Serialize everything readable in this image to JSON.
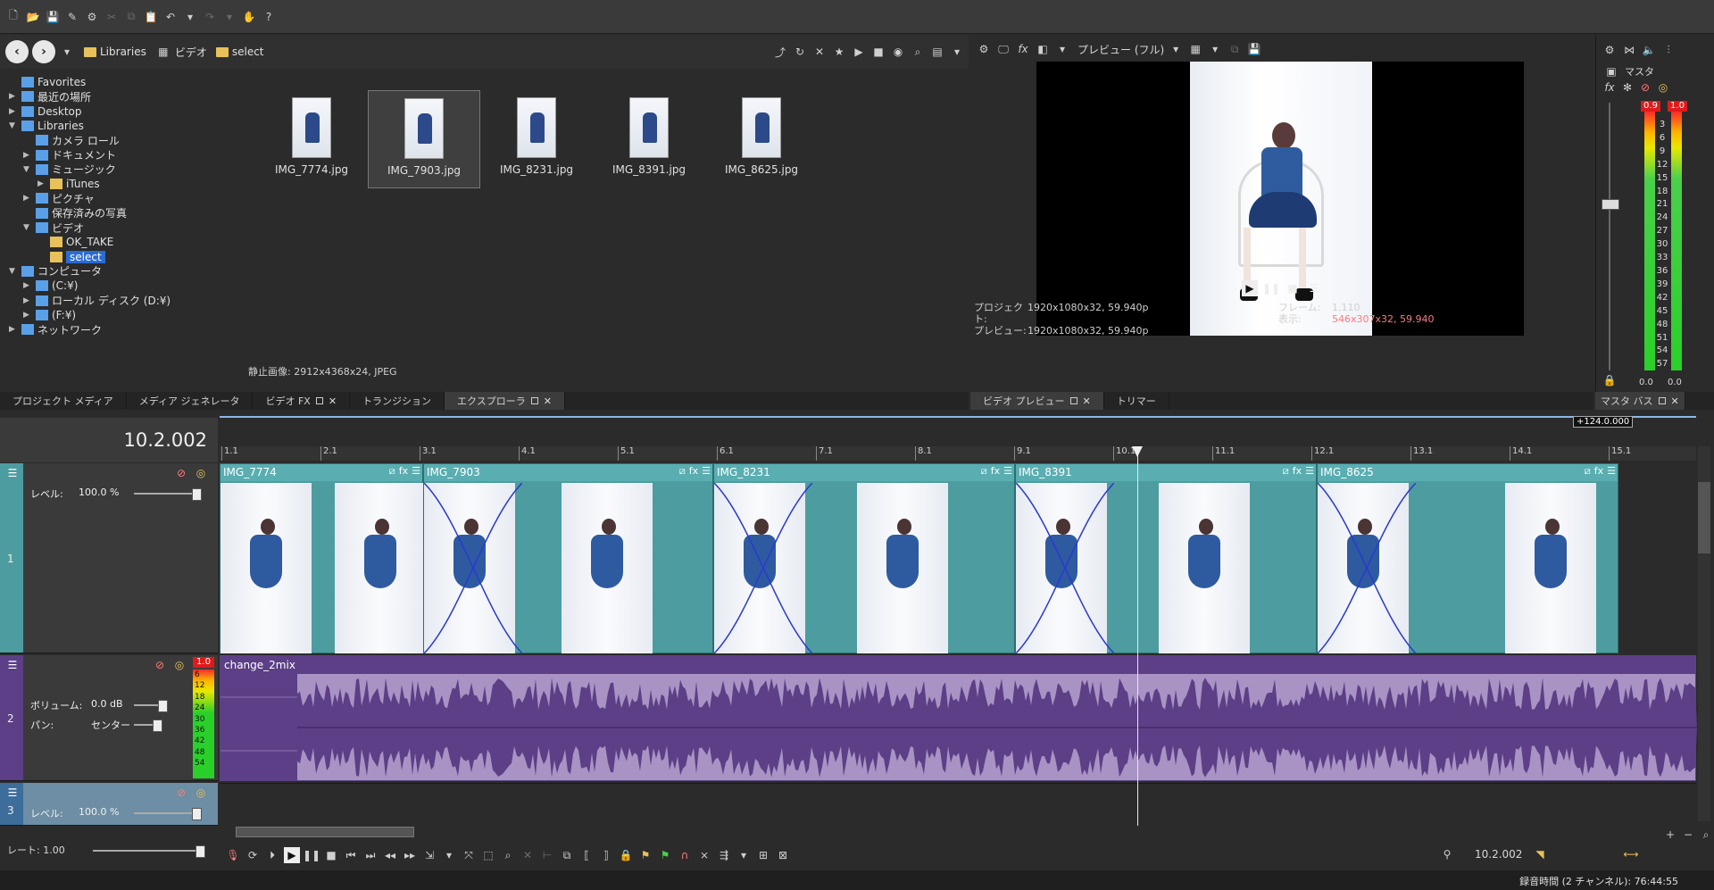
{
  "explorer": {
    "breadcrumb": [
      "Libraries",
      "ビデオ",
      "select"
    ],
    "tree": [
      {
        "label": "Favorites",
        "indent": 0,
        "arrow": ""
      },
      {
        "label": "最近の場所",
        "indent": 0,
        "arrow": "▶"
      },
      {
        "label": "Desktop",
        "indent": 0,
        "arrow": "▶"
      },
      {
        "label": "Libraries",
        "indent": 0,
        "arrow": "▼"
      },
      {
        "label": "カメラ ロール",
        "indent": 1,
        "arrow": ""
      },
      {
        "label": "ドキュメント",
        "indent": 1,
        "arrow": "▶"
      },
      {
        "label": "ミュージック",
        "indent": 1,
        "arrow": "▼"
      },
      {
        "label": "iTunes",
        "indent": 2,
        "arrow": "▶"
      },
      {
        "label": "ピクチャ",
        "indent": 1,
        "arrow": "▶"
      },
      {
        "label": "保存済みの写真",
        "indent": 1,
        "arrow": ""
      },
      {
        "label": "ビデオ",
        "indent": 1,
        "arrow": "▼"
      },
      {
        "label": "OK_TAKE",
        "indent": 2,
        "arrow": ""
      },
      {
        "label": "select",
        "indent": 2,
        "arrow": "",
        "selected": true
      },
      {
        "label": "コンピュータ",
        "indent": 0,
        "arrow": "▼"
      },
      {
        "label": "(C:¥)",
        "indent": 1,
        "arrow": "▶"
      },
      {
        "label": "ローカル ディスク (D:¥)",
        "indent": 1,
        "arrow": "▶"
      },
      {
        "label": "(F:¥)",
        "indent": 1,
        "arrow": "▶"
      },
      {
        "label": "ネットワーク",
        "indent": 0,
        "arrow": "▶"
      }
    ],
    "files": [
      {
        "name": "IMG_7774.jpg",
        "selected": false
      },
      {
        "name": "IMG_7903.jpg",
        "selected": true
      },
      {
        "name": "IMG_8231.jpg",
        "selected": false
      },
      {
        "name": "IMG_8391.jpg",
        "selected": false
      },
      {
        "name": "IMG_8625.jpg",
        "selected": false
      }
    ],
    "status": "静止画像: 2912x4368x24, JPEG",
    "tabs": [
      {
        "label": "プロジェクト メディア"
      },
      {
        "label": "メディア ジェネレータ"
      },
      {
        "label": "ビデオ FX"
      },
      {
        "label": "トランジション"
      },
      {
        "label": "エクスプローラ"
      }
    ]
  },
  "preview": {
    "mode_label": "プレビュー (フル)",
    "info": {
      "project_label": "プロジェクト:",
      "project_value": "1920x1080x32, 59.940p",
      "preview_label": "プレビュー:",
      "preview_value": "1920x1080x32, 59.940p",
      "frame_label": "フレーム:",
      "frame_value": "1,110",
      "display_label": "表示:",
      "display_value": "546x307x32, 59.940"
    },
    "tabs": [
      {
        "label": "ビデオ プレビュー"
      },
      {
        "label": "トリマー"
      }
    ]
  },
  "master": {
    "label": "マスタ",
    "peak_left": "0.9",
    "peak_right": "1.0",
    "scale": [
      "3",
      "6",
      "9",
      "12",
      "15",
      "18",
      "21",
      "24",
      "27",
      "30",
      "33",
      "36",
      "39",
      "42",
      "45",
      "48",
      "51",
      "54",
      "57"
    ],
    "bottom_left": "0.0",
    "bottom_right": "0.0",
    "tab_label": "マスタ バス"
  },
  "timeline": {
    "time_display": "10.2.002",
    "end_marker": "+124.0.000",
    "ruler": [
      "1.1",
      "2.1",
      "3.1",
      "4.1",
      "5.1",
      "6.1",
      "7.1",
      "8.1",
      "9.1",
      "10.1",
      "11.1",
      "12.1",
      "13.1",
      "14.1",
      "15.1"
    ],
    "track1": {
      "num": "1",
      "level_label": "レベル:",
      "level_value": "100.0 %"
    },
    "track2": {
      "num": "2",
      "volume_label": "ボリューム:",
      "volume_value": "0.0 dB",
      "pan_label": "パン:",
      "pan_value": "センター",
      "meter_peak": "1.0",
      "meter_scale": [
        "6",
        "12",
        "18",
        "24",
        "30",
        "36",
        "42",
        "48",
        "54"
      ]
    },
    "track3": {
      "num": "3",
      "level_label": "レベル:",
      "level_value": "100.0 %"
    },
    "video_clips": [
      {
        "name": "IMG_7774"
      },
      {
        "name": "IMG_7903"
      },
      {
        "name": "IMG_8231"
      },
      {
        "name": "IMG_8391"
      },
      {
        "name": "IMG_8625"
      }
    ],
    "audio_clip": "change_2mix",
    "rate_label": "レート: 1.00",
    "transport_time": "10.2.002"
  },
  "status_bar": {
    "text": "録音時間 (2 チャンネル): 76:44:55"
  },
  "colors": {
    "video_clip": "#4d9da0",
    "audio_clip": "#a893c4",
    "audio_header": "#5c3f86",
    "selection": "#2a6bd4"
  }
}
